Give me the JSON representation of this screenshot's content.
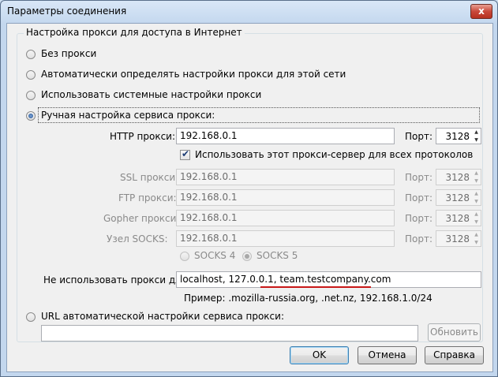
{
  "window": {
    "title": "Параметры соединения",
    "close_glyph": "x"
  },
  "group": {
    "title": "Настройка прокси для доступа в Интернет"
  },
  "options": {
    "no_proxy": "Без прокси",
    "auto_detect": "Автоматически определять настройки прокси для этой сети",
    "system": "Использовать системные настройки прокси",
    "manual": "Ручная настройка сервиса прокси:",
    "pac": "URL автоматической настройки сервиса прокси:"
  },
  "selected_option": "manual",
  "manual": {
    "http_label": "HTTP прокси:",
    "http_value": "192.168.0.1",
    "http_port": "3128",
    "share_label": "Использовать этот прокси-сервер для всех протоколов",
    "share_checked": true,
    "ssl_label": "SSL прокси:",
    "ssl_value": "192.168.0.1",
    "ssl_port": "3128",
    "ftp_label": "FTP прокси:",
    "ftp_value": "192.168.0.1",
    "ftp_port": "3128",
    "gopher_label": "Gopher прокси:",
    "gopher_value": "192.168.0.1",
    "gopher_port": "3128",
    "socks_label": "Узел SOCKS:",
    "socks_value": "192.168.0.1",
    "socks_port": "3128",
    "port_label": "Порт:",
    "socks4": "SOCKS 4",
    "socks5": "SOCKS 5",
    "socks_selected": "SOCKS 5"
  },
  "no_proxy": {
    "label": "Не использовать прокси для:",
    "value": "localhost, 127.0.0.1, team.testcompany.com",
    "example": "Пример: .mozilla-russia.org, .net.nz, 192.168.1.0/24"
  },
  "pac": {
    "url_value": "",
    "reload_label": "Обновить"
  },
  "footer": {
    "ok": "OK",
    "cancel": "Отмена",
    "help": "Справка"
  },
  "colors": {
    "annotation_underline": "#c81818",
    "titlebar": "#c3d7ee",
    "close_button": "#c9483a"
  }
}
